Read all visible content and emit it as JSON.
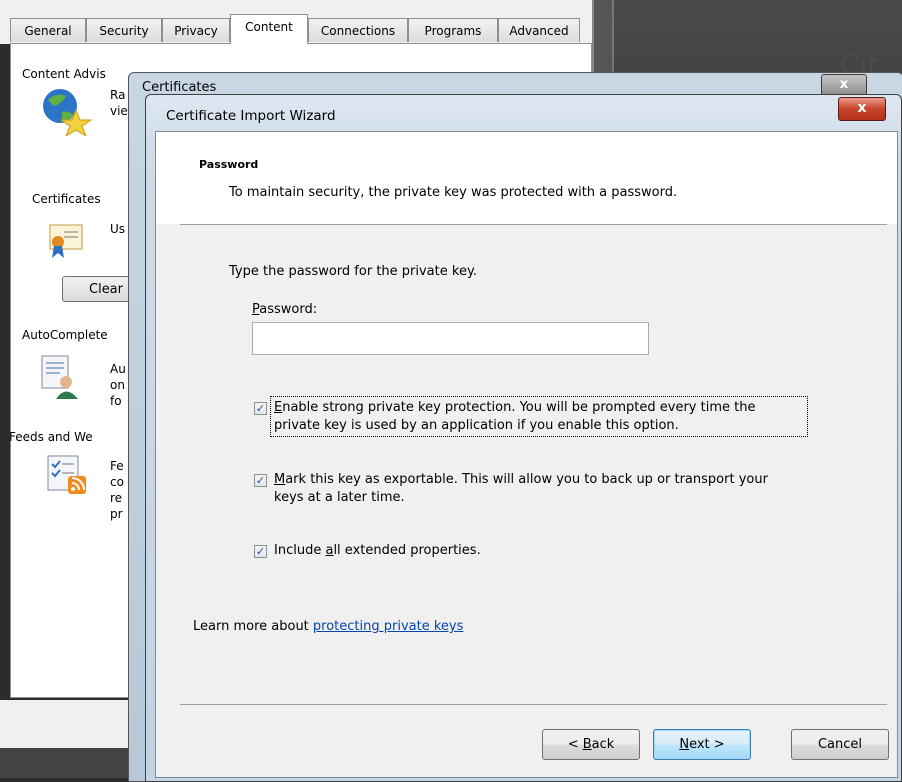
{
  "background_window": {
    "tabs": [
      {
        "label": "General"
      },
      {
        "label": "Security"
      },
      {
        "label": "Privacy"
      },
      {
        "label": "Content",
        "active": true
      },
      {
        "label": "Connections"
      },
      {
        "label": "Programs"
      },
      {
        "label": "Advanced"
      }
    ],
    "content_advisor_label": "Content Advis",
    "content_advisor_text": [
      "Ra",
      "vie"
    ],
    "certificates_label": "Certificates",
    "certificates_text": "Us",
    "clear_button": "Clear",
    "autocomplete_label": "AutoComplete",
    "autocomplete_text": [
      "Au",
      "on",
      "fo"
    ],
    "feeds_label": "Feeds and We",
    "feeds_text": [
      "Fe",
      "co",
      "re",
      "pr"
    ]
  },
  "certificates_dialog": {
    "title": "Certificates",
    "close_glyph": "x"
  },
  "wizard": {
    "title": "Certificate Import Wizard",
    "close_glyph": "x",
    "heading": "Password",
    "subheading": "To maintain security, the private key was protected with a password.",
    "instruction": "Type the password for the private key.",
    "password_label_prefix": "P",
    "password_label_rest": "assword:",
    "password_value": "",
    "options": [
      {
        "checked": true,
        "accel": "E",
        "line1": "nable strong private key protection. You will be prompted every time the",
        "line2": "private key is used by an application if you enable this option."
      },
      {
        "checked": true,
        "accel": "M",
        "line1": "ark this key as exportable. This will allow you to back up or transport your",
        "line2": "keys at a later time."
      },
      {
        "checked": true,
        "pre": "Include ",
        "accel": "a",
        "line1": "ll extended properties."
      }
    ],
    "learn_more_text": "Learn more about ",
    "learn_more_link": "protecting private keys",
    "check_glyph": "✓",
    "buttons": {
      "back_prefix": "< ",
      "back_accel": "B",
      "back_rest": "ack",
      "next_accel": "N",
      "next_rest": "ext >",
      "cancel": "Cancel"
    }
  },
  "colors": {
    "link": "#0645ad",
    "close_red": "#c8452c",
    "title_bar": "#c3d3e2"
  }
}
